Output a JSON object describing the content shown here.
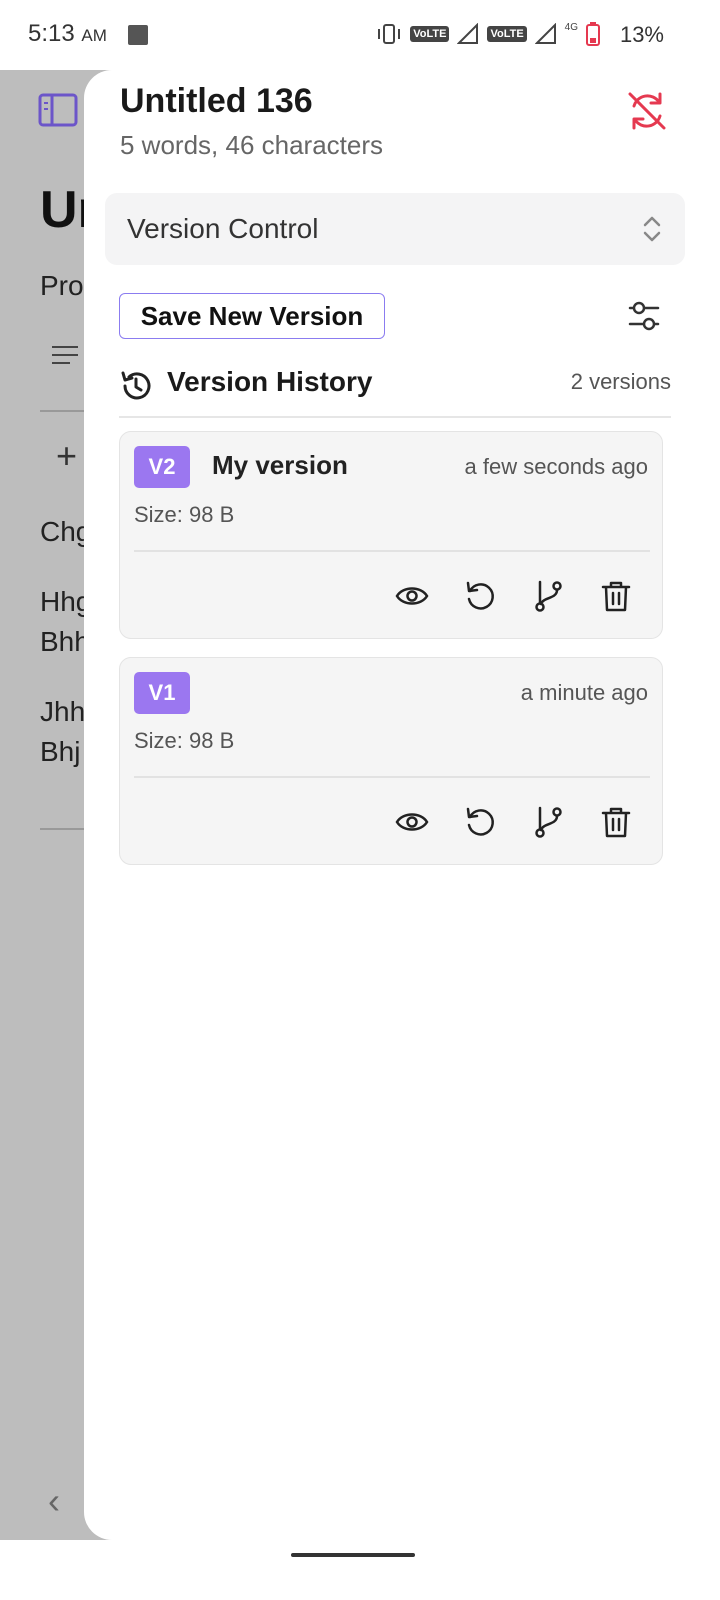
{
  "status_bar": {
    "time": "5:13",
    "ampm": "AM",
    "volte_1": "VoLTE",
    "volte_2": "VoLTE",
    "network": "4G",
    "battery": "13%"
  },
  "background_editor": {
    "title_fragment": "Un",
    "lines": [
      "Pro",
      "Chg",
      "Hhg",
      "Bhh",
      "Jhh",
      "Bhj"
    ]
  },
  "panel": {
    "doc_title": "Untitled 136",
    "doc_stats": "5 words, 46 characters",
    "mode_select": {
      "value": "Version Control"
    },
    "save_button": "Save New Version",
    "history": {
      "title": "Version History",
      "count": "2 versions"
    },
    "versions": [
      {
        "badge": "V2",
        "name": "My version",
        "time": "a few seconds ago",
        "size": "Size: 98 B"
      },
      {
        "badge": "V1",
        "name": "",
        "time": "a minute ago",
        "size": "Size: 98 B"
      }
    ],
    "action_icons": [
      "eye-icon",
      "restore-icon",
      "branch-icon",
      "trash-icon"
    ]
  },
  "colors": {
    "accent": "#9b77f0",
    "sync_off": "#e53950",
    "overlay": "#bdbdbd"
  }
}
